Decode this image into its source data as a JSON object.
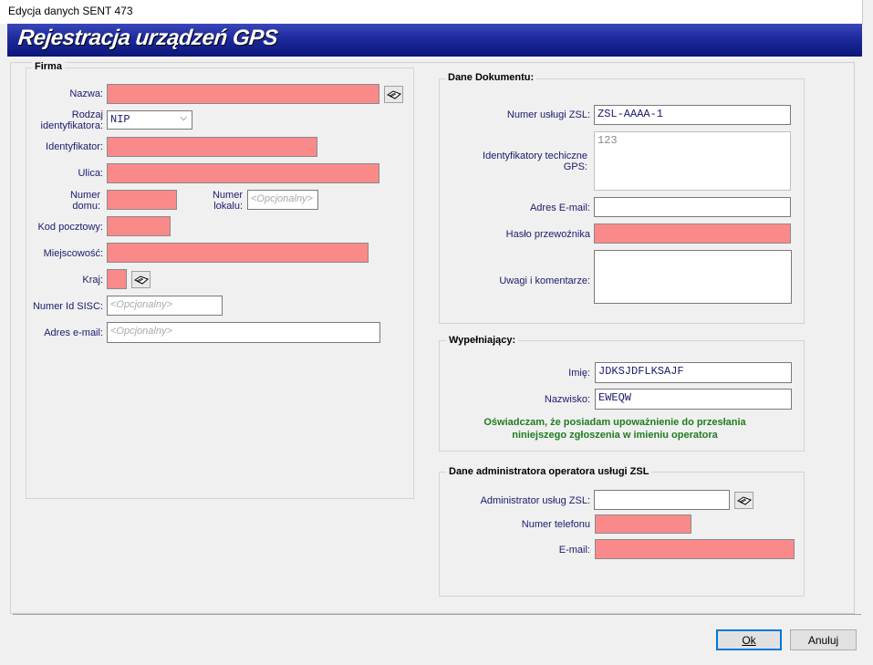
{
  "window": {
    "title": "Edycja danych SENT 473"
  },
  "banner": {
    "title": "Rejestracja urządzeń GPS"
  },
  "firma": {
    "group_title": "Firma",
    "nazwa_label": "Nazwa:",
    "rodzaj_label": "Rodzaj identyfikatora:",
    "rodzaj_value": "NIP",
    "identyfikator_label": "Identyfikator:",
    "ulica_label": "Ulica:",
    "numer_domu_label": "Numer domu:",
    "numer_lokalu_label": "Numer lokalu:",
    "numer_lokalu_placeholder": "<Opcjonalny>",
    "kod_label": "Kod pocztowy:",
    "miejscowosc_label": "Miejscowość:",
    "kraj_label": "Kraj:",
    "sisc_label": "Numer Id SISC:",
    "sisc_placeholder": "<Opcjonalny>",
    "email_label": "Adres e-mail:",
    "email_placeholder": "<Opcjonalny>"
  },
  "dokument": {
    "group_title": "Dane Dokumentu:",
    "numer_uslugi_label": "Numer usługi ZSL:",
    "numer_uslugi_value": "ZSL-AAAA-1",
    "identyfikatory_label": "Identyfikatory techiczne GPS:",
    "identyfikatory_value": "123",
    "adres_email_label": "Adres E-mail:",
    "haslo_label": "Hasło przewoźnika",
    "uwagi_label": "Uwagi i komentarze:"
  },
  "wypelniajacy": {
    "group_title": "Wypełniający:",
    "imie_label": "Imię:",
    "imie_value": "JDKSJDFLKSAJF",
    "nazwisko_label": "Nazwisko:",
    "nazwisko_value": "EWEQW",
    "declaration_line1": "Oświadczam, że posiadam upoważnienie do przesłania",
    "declaration_line2": "niniejszego zgłoszenia w imieniu operatora"
  },
  "administrator": {
    "group_title": "Dane administratora operatora usługi ZSL",
    "admin_label": "Administrator usług ZSL:",
    "telefon_label": "Numer telefonu",
    "email_label": "E-mail:"
  },
  "buttons": {
    "ok": "Ok",
    "anuluj": "Anuluj"
  },
  "colors": {
    "required": "#fa8a8a",
    "banner": "#1d2a9e",
    "label": "#1a1a6e",
    "declaration": "#1e7d1e"
  },
  "icons": {
    "lookup": "book-lookup-icon",
    "dropdown": "chevron-down-icon"
  }
}
